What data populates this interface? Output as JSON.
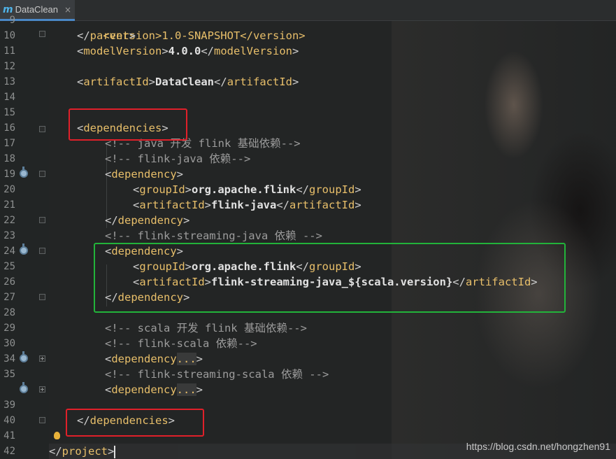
{
  "tab": {
    "icon": "m",
    "label": "DataClean",
    "close": "×"
  },
  "line_numbers": [
    "9",
    "10",
    "11",
    "12",
    "13",
    "14",
    "15",
    "16",
    "17",
    "18",
    "19",
    "20",
    "21",
    "22",
    "23",
    "24",
    "25",
    "26",
    "27",
    "28",
    "29",
    "30",
    "34",
    "35",
    "39",
    "40",
    "41",
    "42"
  ],
  "code": {
    "version_partial": "<version>1.0-SNAPSHOT</version>",
    "parent_close": "parent",
    "modelVersion_tag": "modelVersion",
    "modelVersion_value": "4.0.0",
    "artifactId_tag": "artifactId",
    "artifactId_value": "DataClean",
    "dependencies_tag": "dependencies",
    "comment_java": "<!-- java 开发 flink 基础依赖-->",
    "comment_flink_java": "<!-- flink-java 依赖-->",
    "dependency_tag": "dependency",
    "groupId_tag": "groupId",
    "groupId_value": "org.apache.flink",
    "artifact_flink_java": "flink-java",
    "comment_streaming_java": "<!-- flink-streaming-java 依赖 -->",
    "artifact_streaming_java": "flink-streaming-java_${scala.version}",
    "comment_scala": "<!-- scala 开发 flink 基础依赖-->",
    "comment_flink_scala": "<!-- flink-scala 依赖-->",
    "folded_dots": "...",
    "comment_streaming_scala": "<!-- flink-streaming-scala 依赖 -->",
    "project_tag": "project"
  },
  "watermark": "https://blog.csdn.net/hongzhen91",
  "colors": {
    "tag": "#e8bf6a",
    "comment": "#9c9c9c",
    "red_box": "#e0202a",
    "green_box": "#22b33a"
  }
}
